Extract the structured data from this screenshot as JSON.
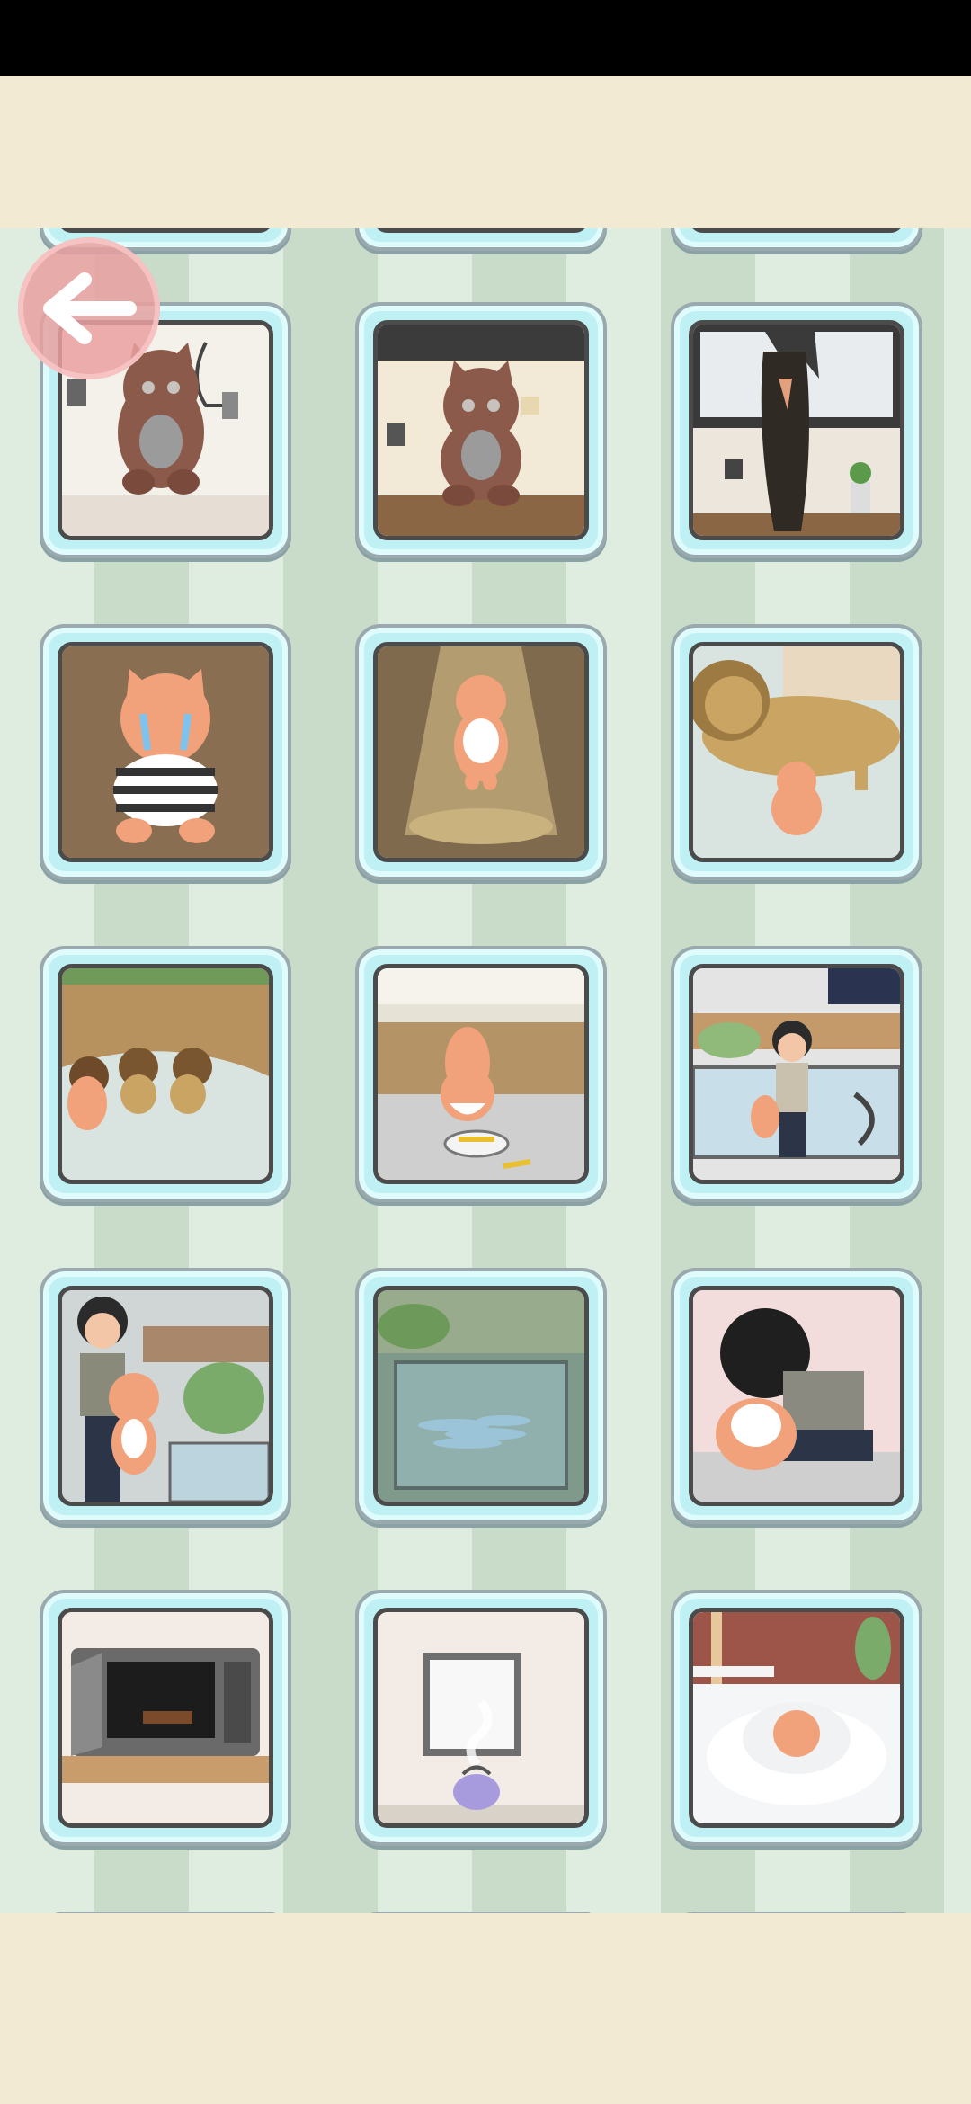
{
  "screen": "level-select",
  "colors": {
    "tile_frame": "#bff0f3",
    "back_button": "#e9a0a0",
    "stripe_light": "#dfece0",
    "stripe_dark": "#c9dcca"
  },
  "back_button": {
    "icon": "left-arrow-icon"
  },
  "levels": [
    {
      "scene": "crying-brown-cat-kitchen"
    },
    {
      "scene": "brown-cat-living-room"
    },
    {
      "scene": "long-hair-ghost-from-tv"
    },
    {
      "scene": "crying-cat-in-striped-shirt"
    },
    {
      "scene": "cat-under-spotlight"
    },
    {
      "scene": "lion-and-small-cat"
    },
    {
      "scene": "cubs-feeding-from-cow"
    },
    {
      "scene": "cat-eating-from-bowl"
    },
    {
      "scene": "boy-and-cat-by-pool"
    },
    {
      "scene": "man-holding-cat-garden"
    },
    {
      "scene": "fish-in-empty-pool"
    },
    {
      "scene": "boy-hugging-cat"
    },
    {
      "scene": "chocolate-in-microwave"
    },
    {
      "scene": "steaming-kettle"
    },
    {
      "scene": "cat-in-snow"
    },
    {
      "scene": "partial-row-1"
    },
    {
      "scene": "partial-row-2"
    },
    {
      "scene": "partial-row-3"
    }
  ]
}
